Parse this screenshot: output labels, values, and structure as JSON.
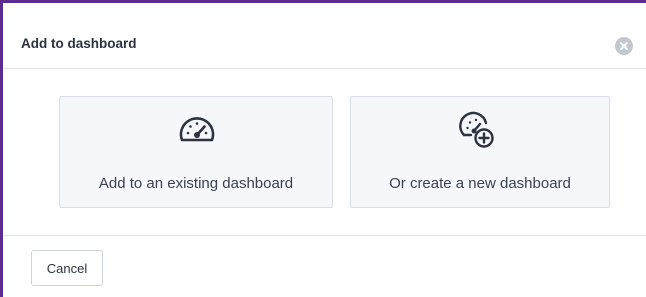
{
  "dialog": {
    "title": "Add to dashboard",
    "close_icon": "close-circle-icon"
  },
  "options": [
    {
      "label": "Add to an existing dashboard",
      "icon": "dashboard-gauge-icon"
    },
    {
      "label": "Or create a new dashboard",
      "icon": "dashboard-add-icon"
    }
  ],
  "footer": {
    "cancel_label": "Cancel"
  },
  "colors": {
    "frame_accent": "#5c2d91",
    "card_background": "#f5f7fb",
    "icon_color": "#2b3340"
  }
}
